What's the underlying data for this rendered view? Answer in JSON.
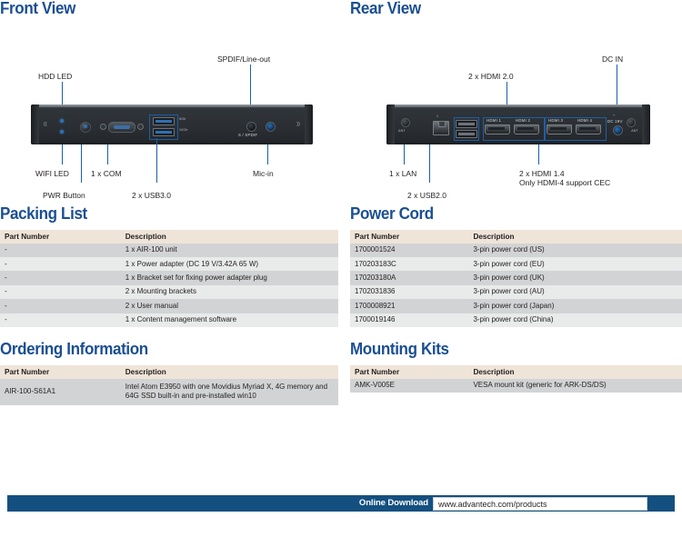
{
  "front_view": {
    "title": "Front View",
    "callouts": [
      {
        "label": "HDD LED"
      },
      {
        "label": "SPDIF/Line-out"
      },
      {
        "label": "WIFI LED"
      },
      {
        "label": "1 x COM"
      },
      {
        "label": "Mic-in"
      },
      {
        "label": "PWR Button"
      },
      {
        "label": "2 x USB3.0"
      }
    ],
    "port_marks": {
      "spdif": "S / SPDIF",
      "usb_top": "5Gb",
      "usb_bottom": "10Gb",
      "com": "IOIOI"
    }
  },
  "rear_view": {
    "title": "Rear View",
    "callouts": [
      {
        "label": "2 x HDMI 2.0"
      },
      {
        "label": "DC IN"
      },
      {
        "label": "1 x LAN"
      },
      {
        "label": "2 x USB2.0"
      },
      {
        "label": "2 x HDMI 1.4"
      },
      {
        "label": "Only HDMI-4 support CEC"
      }
    ],
    "port_marks": {
      "ant_left": "ANT",
      "ant_right": "ANT",
      "lan": "1",
      "hdmi1": "HDMI 1",
      "hdmi2": "HDMI 2",
      "hdmi3": "HDMI 3",
      "hdmi4": "HDMI 4",
      "dc_polarity": "+",
      "dc": "DC 19V"
    }
  },
  "packing_list": {
    "title": "Packing List",
    "headers": {
      "part": "Part Number",
      "description": "Description"
    },
    "rows": [
      {
        "part": "-",
        "description": "1 x AIR-100 unit"
      },
      {
        "part": "-",
        "description": "1 x Power adapter (DC 19 V/3.42A 65 W)"
      },
      {
        "part": "-",
        "description": "1 x Bracket set for fixing power adapter plug"
      },
      {
        "part": "-",
        "description": "2 x Mounting brackets"
      },
      {
        "part": "-",
        "description": "2 x User manual"
      },
      {
        "part": "-",
        "description": "1 x Content management software"
      }
    ]
  },
  "power_cord": {
    "title": "Power Cord",
    "headers": {
      "part": "Part Number",
      "description": "Description"
    },
    "rows": [
      {
        "part": "1700001524",
        "description": "3-pin power cord (US)"
      },
      {
        "part": "170203183C",
        "description": "3-pin power cord (EU)"
      },
      {
        "part": "170203180A",
        "description": "3-pin power cord (UK)"
      },
      {
        "part": "1702031836",
        "description": "3-pin power cord (AU)"
      },
      {
        "part": "1700008921",
        "description": "3-pin power cord (Japan)"
      },
      {
        "part": "1700019146",
        "description": "3-pin power cord (China)"
      }
    ]
  },
  "ordering_information": {
    "title": "Ordering Information",
    "headers": {
      "part": "Part Number",
      "description": "Description"
    },
    "rows": [
      {
        "part": "AIR-100-S61A1",
        "description": "Intel Atom E3950 with one Movidius Myriad X, 4G memory and 64G SSD built-in and pre-installed win10"
      }
    ]
  },
  "mounting_kits": {
    "title": "Mounting Kits",
    "headers": {
      "part": "Part Number",
      "description": "Description"
    },
    "rows": [
      {
        "part": "AMK-V005E",
        "description": "VESA mount kit (generic for ARK-DS/DS)"
      }
    ]
  },
  "footer": {
    "label": "Online Download",
    "url": "www.advantech.com/products"
  },
  "colors": {
    "heading_blue": "#1b4f93",
    "footer_blue": "#14507f",
    "table_header_beige": "#efe4d8",
    "row_dark": "#d2d3d4",
    "row_light": "#e9eaea",
    "leader_blue": "#1b5fa8"
  }
}
